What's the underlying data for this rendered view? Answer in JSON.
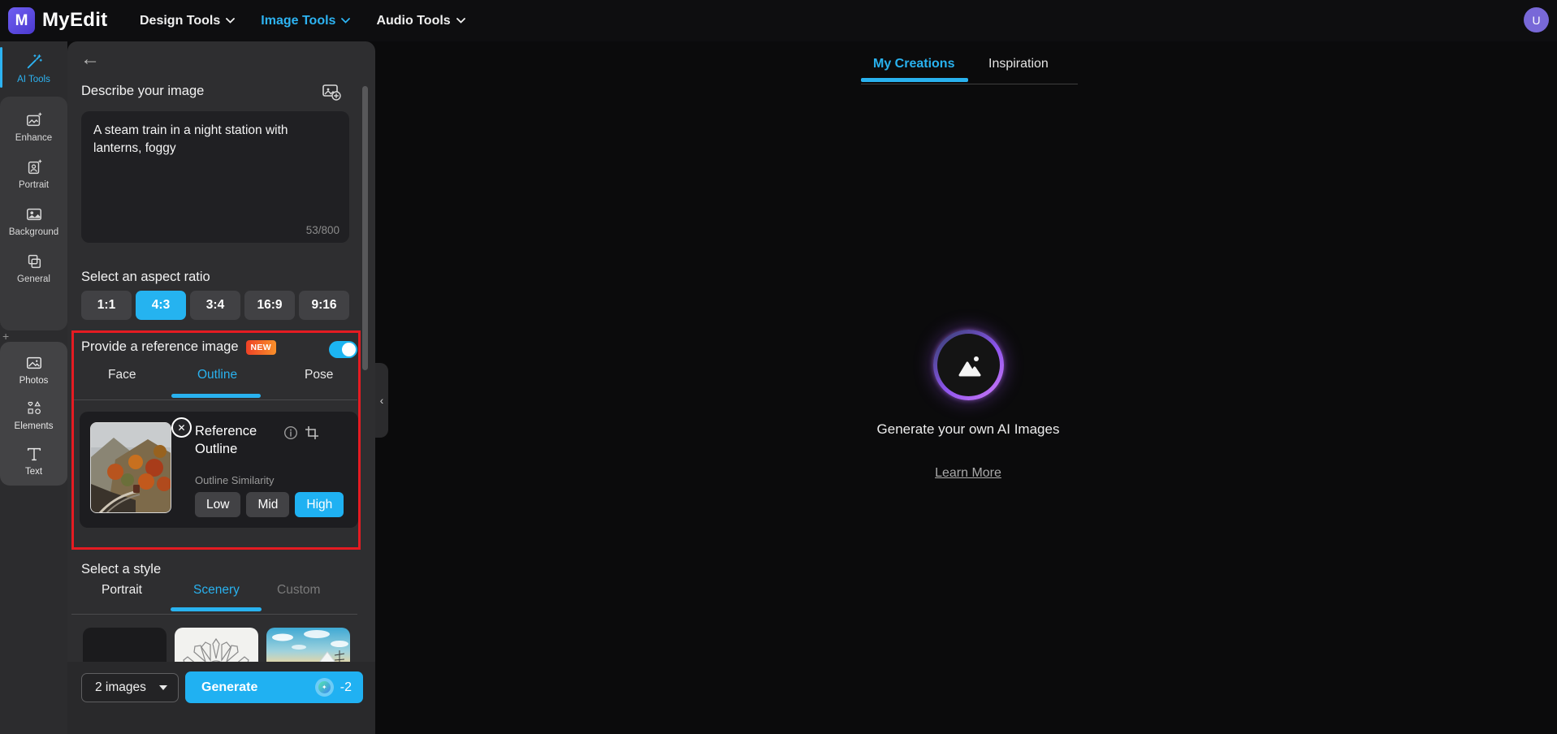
{
  "navbar": {
    "brand": "MyEdit",
    "logo_letter": "M",
    "menus": [
      {
        "label": "Design Tools",
        "active": false
      },
      {
        "label": "Image Tools",
        "active": true
      },
      {
        "label": "Audio Tools",
        "active": false
      }
    ],
    "avatar_letter": "U"
  },
  "rail": {
    "items": [
      {
        "label": "AI Tools",
        "icon": "magic-wand-icon",
        "active": true
      },
      {
        "label": "Enhance",
        "icon": "enhance-image-icon"
      },
      {
        "label": "Portrait",
        "icon": "portrait-icon"
      },
      {
        "label": "Background",
        "icon": "background-image-icon"
      },
      {
        "label": "General",
        "icon": "overlap-squares-icon"
      },
      {
        "label": "Photos",
        "icon": "photo-icon"
      },
      {
        "label": "Elements",
        "icon": "shapes-icon"
      },
      {
        "label": "Text",
        "icon": "text-icon"
      }
    ]
  },
  "panel": {
    "describe": {
      "label": "Describe your image",
      "value": "A steam train in a night station with lanterns, foggy",
      "counter": "53/800"
    },
    "aspect": {
      "label": "Select an aspect ratio",
      "options": [
        "1:1",
        "4:3",
        "3:4",
        "16:9",
        "9:16"
      ],
      "selected": "4:3"
    },
    "reference": {
      "label": "Provide a reference image",
      "badge": "NEW",
      "toggle_on": true,
      "tabs": [
        "Face",
        "Outline",
        "Pose"
      ],
      "active_tab": "Outline",
      "card": {
        "title": "Reference Outline",
        "similarity_label": "Outline Similarity",
        "levels": [
          "Low",
          "Mid",
          "High"
        ],
        "selected_level": "High"
      }
    },
    "style": {
      "label": "Select a style",
      "tabs": [
        "Portrait",
        "Scenery",
        "Custom"
      ],
      "active_tab": "Scenery",
      "disabled_tab": "Custom"
    },
    "footer": {
      "count_label": "2 images",
      "generate_label": "Generate",
      "credit_cost": "-2"
    }
  },
  "content": {
    "tabs": [
      {
        "label": "My Creations",
        "active": true
      },
      {
        "label": "Inspiration",
        "active": false
      }
    ],
    "empty_title": "Generate your own AI Images",
    "link_label": "Learn More"
  },
  "colors": {
    "accent": "#25b3f0",
    "highlight_box": "#e51b22",
    "new_badge": "#f4571f",
    "avatar_bg": "#7868d8",
    "glow_ring": "#8e55ee"
  }
}
